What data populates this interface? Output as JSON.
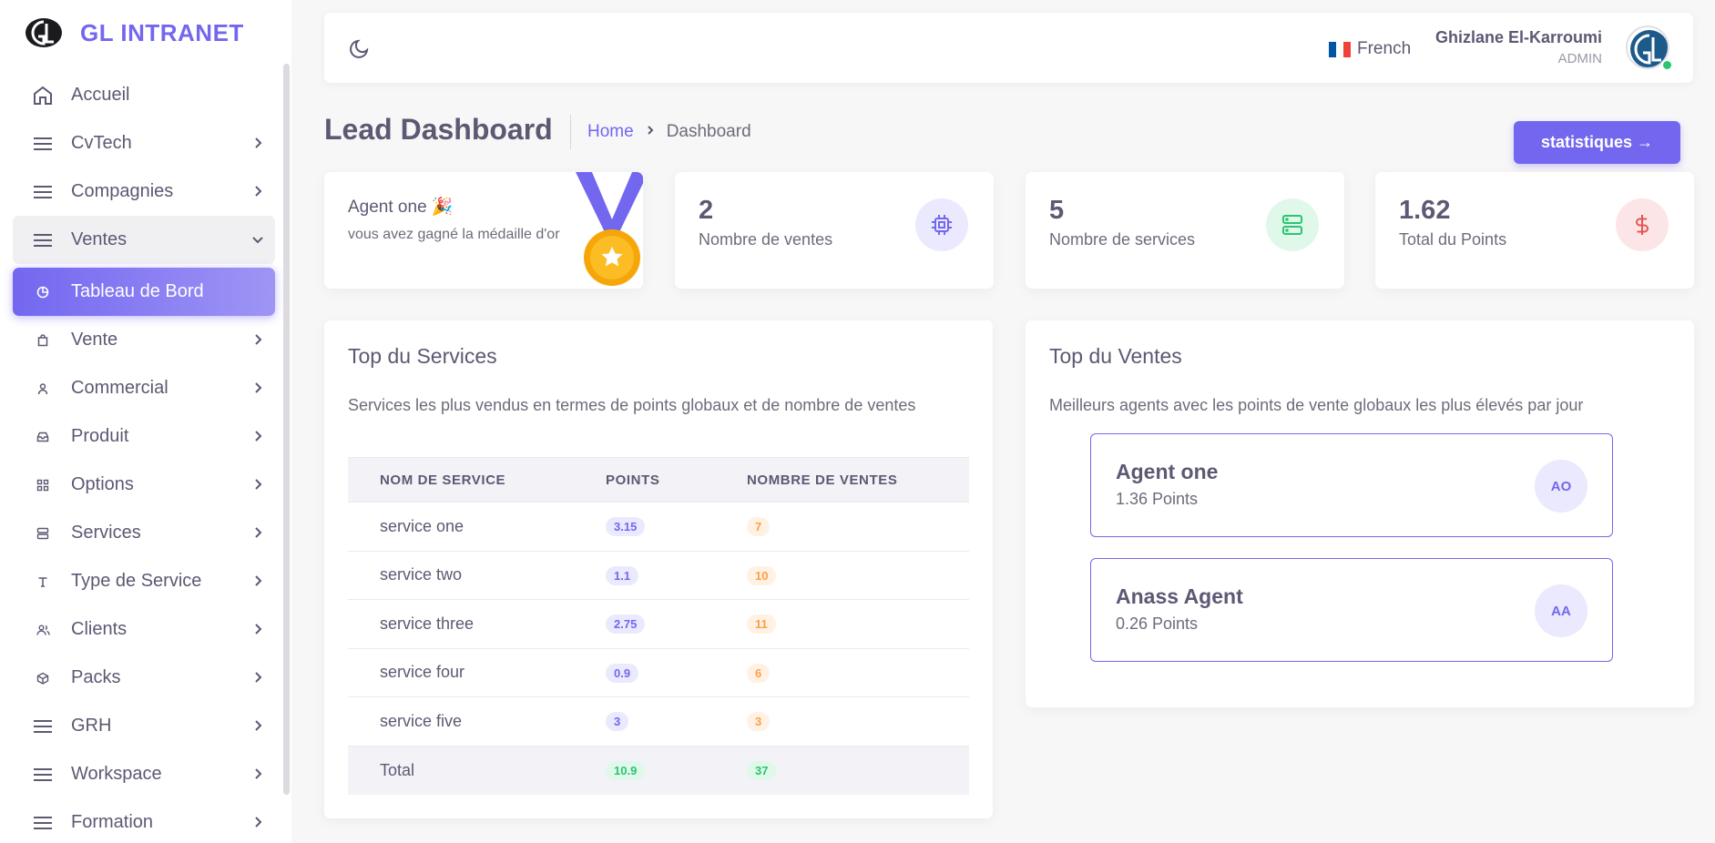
{
  "app": {
    "name": "GL INTRANET"
  },
  "sidebar": {
    "items": [
      {
        "label": "Accueil",
        "icon": "home-icon"
      },
      {
        "label": "CvTech",
        "icon": "menu-icon"
      },
      {
        "label": "Compagnies",
        "icon": "menu-icon"
      },
      {
        "label": "Ventes",
        "icon": "menu-icon"
      },
      {
        "label": "Tableau de Bord",
        "icon": "pie-chart-icon"
      },
      {
        "label": "Vente",
        "icon": "shopping-bag-icon"
      },
      {
        "label": "Commercial",
        "icon": "user-icon"
      },
      {
        "label": "Produit",
        "icon": "inbox-icon"
      },
      {
        "label": "Options",
        "icon": "grid-icon"
      },
      {
        "label": "Services",
        "icon": "server-icon"
      },
      {
        "label": "Type de Service",
        "icon": "type-icon"
      },
      {
        "label": "Clients",
        "icon": "users-icon"
      },
      {
        "label": "Packs",
        "icon": "package-icon"
      },
      {
        "label": "GRH",
        "icon": "menu-icon"
      },
      {
        "label": "Workspace",
        "icon": "menu-icon"
      },
      {
        "label": "Formation",
        "icon": "menu-icon"
      }
    ]
  },
  "header": {
    "language": "French",
    "user_name": "Ghizlane El-Karroumi",
    "user_role": "ADMIN"
  },
  "page": {
    "title": "Lead Dashboard",
    "breadcrumb_home": "Home",
    "breadcrumb_current": "Dashboard",
    "stat_button": "statistiques →"
  },
  "congrats": {
    "title": "Agent one 🎉",
    "subtitle": "vous avez gagné la médaille d'or"
  },
  "stats": [
    {
      "value": "2",
      "label": "Nombre de ventes",
      "icon": "cpu-icon",
      "color": "#7367f0",
      "bg": "#ebe9fd"
    },
    {
      "value": "5",
      "label": "Nombre de services",
      "icon": "server-icon",
      "color": "#28c76f",
      "bg": "#e0f8ea"
    },
    {
      "value": "1.62",
      "label": "Total du Points",
      "icon": "dollar-icon",
      "color": "#ea5455",
      "bg": "#fce5e6"
    }
  ],
  "top_services": {
    "title": "Top du Services",
    "description": "Services les plus vendus en termes de points globaux et de nombre de ventes",
    "headers": [
      "NOM DE SERVICE",
      "POINTS",
      "NOMBRE DE VENTES"
    ],
    "rows": [
      {
        "name": "service one",
        "points": "3.15",
        "ventes": "7"
      },
      {
        "name": "service two",
        "points": "1.1",
        "ventes": "10"
      },
      {
        "name": "service three",
        "points": "2.75",
        "ventes": "11"
      },
      {
        "name": "service four",
        "points": "0.9",
        "ventes": "6"
      },
      {
        "name": "service five",
        "points": "3",
        "ventes": "3"
      }
    ],
    "total": {
      "name": "Total",
      "points": "10.9",
      "ventes": "37"
    }
  },
  "top_ventes": {
    "title": "Top du Ventes",
    "description": "Meilleurs agents avec les points de vente globaux les plus élevés par jour",
    "agents": [
      {
        "name": "Agent one",
        "points": "1.36 Points",
        "initials": "AO"
      },
      {
        "name": "Anass Agent",
        "points": "0.26 Points",
        "initials": "AA"
      }
    ]
  },
  "colors": {
    "accent": "#7367f0",
    "success": "#28c76f",
    "warning": "#ff9f43",
    "danger": "#ea5455"
  }
}
